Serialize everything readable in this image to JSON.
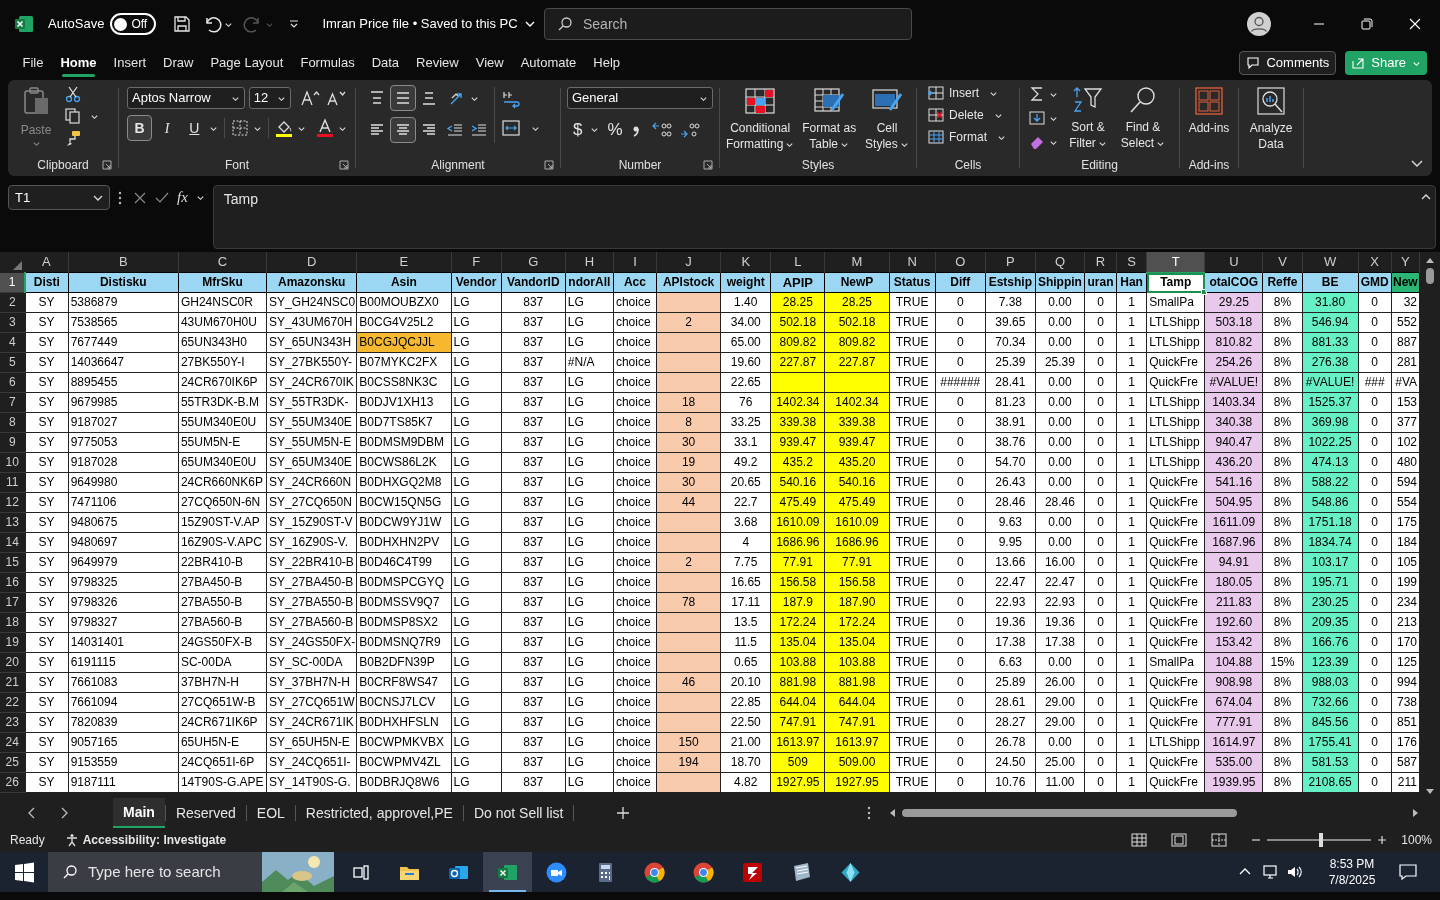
{
  "title_bar": {
    "autosave": "AutoSave",
    "autosave_state": "Off",
    "autosave_on": false,
    "document": "Imran Price file • Saved to this PC",
    "search_placeholder": "Search"
  },
  "menu": [
    {
      "label": "File",
      "selected": false
    },
    {
      "label": "Home",
      "selected": true
    },
    {
      "label": "Insert",
      "selected": false
    },
    {
      "label": "Draw",
      "selected": false
    },
    {
      "label": "Page Layout",
      "selected": false
    },
    {
      "label": "Formulas",
      "selected": false
    },
    {
      "label": "Data",
      "selected": false
    },
    {
      "label": "Review",
      "selected": false
    },
    {
      "label": "View",
      "selected": false
    },
    {
      "label": "Automate",
      "selected": false
    },
    {
      "label": "Help",
      "selected": false
    }
  ],
  "comments": "Comments",
  "share": "Share",
  "ribbon": {
    "clipboard": {
      "paste": "Paste",
      "label": "Clipboard"
    },
    "font": {
      "name": "Aptos Narrow",
      "size": "12",
      "label": "Font",
      "buttons": [
        {
          "label": "B",
          "kind": "bold",
          "selected": true
        },
        {
          "label": "I",
          "kind": "italic",
          "selected": false
        },
        {
          "label": "U",
          "kind": "underline",
          "selected": false
        }
      ]
    },
    "alignment": {
      "label": "Alignment",
      "vertical": [
        {
          "kind": "top",
          "selected": false
        },
        {
          "kind": "middle",
          "selected": true
        },
        {
          "kind": "bottom",
          "selected": false
        }
      ],
      "horizontal": [
        {
          "kind": "left",
          "selected": false
        },
        {
          "kind": "center",
          "selected": true
        },
        {
          "kind": "right",
          "selected": false
        }
      ]
    },
    "number": {
      "format": "General",
      "label": "Number",
      "symbols": [
        "$",
        "%"
      ]
    },
    "styles": {
      "label": "Styles",
      "buttons": [
        "Conditional Formatting",
        "Format as Table",
        "Cell Styles"
      ]
    },
    "cells": {
      "label": "Cells",
      "buttons": [
        "Insert",
        "Delete",
        "Format"
      ]
    },
    "editing": {
      "label": "Editing",
      "buttons": [
        "Sort & Filter",
        "Find & Select"
      ]
    },
    "addins": {
      "label": "Add-ins",
      "button": "Add-ins"
    },
    "analyze": {
      "button": "Analyze Data"
    }
  },
  "formula_bar": {
    "name_box": "T1",
    "function_label": "fx",
    "formula": "Tamp"
  },
  "sheet": {
    "header_row": {
      "number": "1",
      "selected": true
    },
    "columns": [
      {
        "letter": "A",
        "header": "Disti",
        "selected": false
      },
      {
        "letter": "B",
        "header": "Distisku",
        "selected": false
      },
      {
        "letter": "C",
        "header": "MfrSku",
        "selected": false
      },
      {
        "letter": "D",
        "header": "Amazonsku",
        "selected": false
      },
      {
        "letter": "E",
        "header": "Asin",
        "selected": false
      },
      {
        "letter": "F",
        "header": "Vendor",
        "selected": false
      },
      {
        "letter": "G",
        "header": "VandorID",
        "selected": false
      },
      {
        "letter": "H",
        "header": "ndorAll",
        "selected": false
      },
      {
        "letter": "I",
        "header": "Acc",
        "selected": false
      },
      {
        "letter": "J",
        "header": "APIstock",
        "selected": false,
        "color": "#f8cbad"
      },
      {
        "letter": "K",
        "header": "weight",
        "selected": false
      },
      {
        "letter": "L",
        "header": {
          "text": "APIP",
          "kind": "colored-text"
        },
        "selected": false,
        "color": "#ffff00"
      },
      {
        "letter": "M",
        "header": "NewP",
        "selected": false,
        "color": "#ffff00"
      },
      {
        "letter": "N",
        "header": "Status",
        "selected": false
      },
      {
        "letter": "O",
        "header": "Diff",
        "selected": false
      },
      {
        "letter": "P",
        "header": "Estship",
        "selected": false
      },
      {
        "letter": "Q",
        "header": "Shippin",
        "selected": false
      },
      {
        "letter": "R",
        "header": "uran",
        "selected": false
      },
      {
        "letter": "S",
        "header": "Han",
        "selected": false
      },
      {
        "letter": "T",
        "header": "Tamp",
        "selected": true
      },
      {
        "letter": "U",
        "header": "otalCOG",
        "selected": false,
        "color": "#e8c9ec"
      },
      {
        "letter": "V",
        "header": "Reffe",
        "selected": false
      },
      {
        "letter": "W",
        "header": "BE",
        "selected": false,
        "color": "#66f0c6"
      },
      {
        "letter": "X",
        "header": "GMD",
        "selected": false
      },
      {
        "letter": "Y",
        "header": {
          "text": "New",
          "kind": "filled",
          "color": "#2bb673"
        },
        "selected": false
      }
    ],
    "rows": [
      {
        "number": "2",
        "selected": false,
        "cells": [
          "SY",
          "5386879",
          "GH24NSC0R",
          "SY_GH24NSC0",
          "B00MOUBZX0",
          "LG",
          "837",
          "LG",
          "choice",
          null,
          "1.40",
          "28.25",
          "28.25",
          "TRUE",
          "0",
          "7.38",
          "0.00",
          "0",
          "1",
          "SmallPa",
          "29.25",
          "8%",
          "31.80",
          "0",
          "32"
        ]
      },
      {
        "number": "3",
        "selected": false,
        "cells": [
          "SY",
          "7538565",
          "43UM670H0U",
          "SY_43UM670H",
          "B0CG4V25L2",
          "LG",
          "837",
          "LG",
          "choice",
          "2",
          "34.00",
          "502.18",
          "502.18",
          "TRUE",
          "0",
          "39.65",
          "0.00",
          "0",
          "1",
          "LTLShipp",
          "503.18",
          "8%",
          "546.94",
          "0",
          "552"
        ]
      },
      {
        "number": "4",
        "selected": false,
        "cells": [
          "SY",
          "7677449",
          "65UN343H0",
          "SY_65UN343H",
          {
            "text": "B0CGJQCJJL",
            "color": "#f5b82e"
          },
          "LG",
          "837",
          "LG",
          "choice",
          null,
          "65.00",
          "809.82",
          "809.82",
          "TRUE",
          "0",
          "70.34",
          "0.00",
          "0",
          "1",
          "LTLShipp",
          "810.82",
          "8%",
          "881.33",
          "0",
          "887"
        ]
      },
      {
        "number": "5",
        "selected": false,
        "cells": [
          "SY",
          "14036647",
          "27BK550Y-I",
          "SY_27BK550Y-",
          "B07MYKC2FX",
          "LG",
          "837",
          "#N/A",
          "choice",
          null,
          "19.60",
          "227.87",
          "227.87",
          "TRUE",
          "0",
          "25.39",
          "25.39",
          "0",
          "1",
          "QuickFre",
          "254.26",
          "8%",
          "276.38",
          "0",
          "281"
        ]
      },
      {
        "number": "6",
        "selected": false,
        "cells": [
          "SY",
          "8895455",
          "24CR670IK6P",
          "SY_24CR670IK",
          "B0CSS8NK3C",
          "LG",
          "837",
          "LG",
          "choice",
          null,
          "22.65",
          null,
          null,
          "TRUE",
          "######",
          "28.41",
          "0.00",
          "0",
          "1",
          "QuickFre",
          "#VALUE!",
          "8%",
          "#VALUE!",
          "###",
          "#VA"
        ]
      },
      {
        "number": "7",
        "selected": false,
        "cells": [
          "SY",
          "9679985",
          "55TR3DK-B.M",
          "SY_55TR3DK-",
          "B0DJV1XH13",
          "LG",
          "837",
          "LG",
          "choice",
          "18",
          "76",
          "1402.34",
          "1402.34",
          "TRUE",
          "0",
          "81.23",
          "0.00",
          "0",
          "1",
          "LTLShipp",
          "1403.34",
          "8%",
          "1525.37",
          "0",
          "153"
        ]
      },
      {
        "number": "8",
        "selected": false,
        "cells": [
          "SY",
          "9187027",
          "55UM340E0U",
          "SY_55UM340E",
          "B0D7TS85K7",
          "LG",
          "837",
          "LG",
          "choice",
          "8",
          "33.25",
          "339.38",
          "339.38",
          "TRUE",
          "0",
          "38.91",
          "0.00",
          "0",
          "1",
          "LTLShipp",
          "340.38",
          "8%",
          "369.98",
          "0",
          "377"
        ]
      },
      {
        "number": "9",
        "selected": false,
        "cells": [
          "SY",
          "9775053",
          "55UM5N-E",
          "SY_55UM5N-E",
          "B0DMSM9DBM",
          "LG",
          "837",
          "LG",
          "choice",
          "30",
          "33.1",
          "939.47",
          "939.47",
          "TRUE",
          "0",
          "38.76",
          "0.00",
          "0",
          "1",
          "LTLShipp",
          "940.47",
          "8%",
          "1022.25",
          "0",
          "102"
        ]
      },
      {
        "number": "10",
        "selected": false,
        "cells": [
          "SY",
          "9187028",
          "65UM340E0U",
          "SY_65UM340E",
          "B0CWS86L2K",
          "LG",
          "837",
          "LG",
          "choice",
          "19",
          "49.2",
          "435.2",
          "435.20",
          "TRUE",
          "0",
          "54.70",
          "0.00",
          "0",
          "1",
          "LTLShipp",
          "436.20",
          "8%",
          "474.13",
          "0",
          "480"
        ]
      },
      {
        "number": "11",
        "selected": false,
        "cells": [
          "SY",
          "9649980",
          "24CR660NK6P",
          "SY_24CR660N",
          "B0DHXGQ2M8",
          "LG",
          "837",
          "LG",
          "choice",
          "30",
          "20.65",
          "540.16",
          "540.16",
          "TRUE",
          "0",
          "26.43",
          "0.00",
          "0",
          "1",
          "QuickFre",
          "541.16",
          "8%",
          "588.22",
          "0",
          "594"
        ]
      },
      {
        "number": "12",
        "selected": false,
        "cells": [
          "SY",
          "7471106",
          "27CQ650N-6N",
          "SY_27CQ650N",
          "B0CW15QN5G",
          "LG",
          "837",
          "LG",
          "choice",
          "44",
          "22.7",
          "475.49",
          "475.49",
          "TRUE",
          "0",
          "28.46",
          "28.46",
          "0",
          "1",
          "QuickFre",
          "504.95",
          "8%",
          "548.86",
          "0",
          "554"
        ]
      },
      {
        "number": "13",
        "selected": false,
        "cells": [
          "SY",
          "9480675",
          "15Z90ST-V.AP",
          "SY_15Z90ST-V",
          "B0DCW9YJ1W",
          "LG",
          "837",
          "LG",
          "choice",
          null,
          "3.68",
          "1610.09",
          "1610.09",
          "TRUE",
          "0",
          "9.63",
          "0.00",
          "0",
          "1",
          "QuickFre",
          "1611.09",
          "8%",
          "1751.18",
          "0",
          "175"
        ]
      },
      {
        "number": "14",
        "selected": false,
        "cells": [
          "SY",
          "9480697",
          "16Z90S-V.APC",
          "SY_16Z90S-V.",
          "B0DHXHN2PV",
          "LG",
          "837",
          "LG",
          "choice",
          null,
          "4",
          "1686.96",
          "1686.96",
          "TRUE",
          "0",
          "9.95",
          "0.00",
          "0",
          "1",
          "QuickFre",
          "1687.96",
          "8%",
          "1834.74",
          "0",
          "184"
        ]
      },
      {
        "number": "15",
        "selected": false,
        "cells": [
          "SY",
          "9649979",
          "22BR410-B",
          "SY_22BR410-B",
          "B0D46C4T99",
          "LG",
          "837",
          "LG",
          "choice",
          "2",
          "7.75",
          "77.91",
          "77.91",
          "TRUE",
          "0",
          "13.66",
          "16.00",
          "0",
          "1",
          "QuickFre",
          "94.91",
          "8%",
          "103.17",
          "0",
          "105"
        ]
      },
      {
        "number": "16",
        "selected": false,
        "cells": [
          "SY",
          "9798325",
          "27BA450-B",
          "SY_27BA450-B",
          "B0DMSPCGYQ",
          "LG",
          "837",
          "LG",
          "choice",
          null,
          "16.65",
          "156.58",
          "156.58",
          "TRUE",
          "0",
          "22.47",
          "22.47",
          "0",
          "1",
          "QuickFre",
          "180.05",
          "8%",
          "195.71",
          "0",
          "199"
        ]
      },
      {
        "number": "17",
        "selected": false,
        "cells": [
          "SY",
          "9798326",
          "27BA550-B",
          "SY_27BA550-B",
          "B0DMSSV9Q7",
          "LG",
          "837",
          "LG",
          "choice",
          "78",
          "17.11",
          "187.9",
          "187.90",
          "TRUE",
          "0",
          "22.93",
          "22.93",
          "0",
          "1",
          "QuickFre",
          "211.83",
          "8%",
          "230.25",
          "0",
          "234"
        ]
      },
      {
        "number": "18",
        "selected": false,
        "cells": [
          "SY",
          "9798327",
          "27BA560-B",
          "SY_27BA560-B",
          "B0DMSP8SX2",
          "LG",
          "837",
          "LG",
          "choice",
          null,
          "13.5",
          "172.24",
          "172.24",
          "TRUE",
          "0",
          "19.36",
          "19.36",
          "0",
          "1",
          "QuickFre",
          "192.60",
          "8%",
          "209.35",
          "0",
          "213"
        ]
      },
      {
        "number": "19",
        "selected": false,
        "cells": [
          "SY",
          "14031401",
          "24GS50FX-B",
          "SY_24GS50FX-",
          "B0DMSNQ7R9",
          "LG",
          "837",
          "LG",
          "choice",
          null,
          "11.5",
          "135.04",
          "135.04",
          "TRUE",
          "0",
          "17.38",
          "17.38",
          "0",
          "1",
          "QuickFre",
          "153.42",
          "8%",
          "166.76",
          "0",
          "170"
        ]
      },
      {
        "number": "20",
        "selected": false,
        "cells": [
          "SY",
          "6191115",
          "SC-00DA",
          "SY_SC-00DA",
          "B0B2DFN39P",
          "LG",
          "837",
          "LG",
          "choice",
          null,
          "0.65",
          "103.88",
          "103.88",
          "TRUE",
          "0",
          "6.63",
          "0.00",
          "0",
          "1",
          "SmallPa",
          "104.88",
          "15%",
          "123.39",
          "0",
          "125"
        ]
      },
      {
        "number": "21",
        "selected": false,
        "cells": [
          "SY",
          "7661083",
          "37BH7N-H",
          "SY_37BH7N-H",
          "B0CRF8WS47",
          "LG",
          "837",
          "LG",
          "choice",
          "46",
          "20.10",
          "881.98",
          "881.98",
          "TRUE",
          "0",
          "25.89",
          "26.00",
          "0",
          "1",
          "QuickFre",
          "908.98",
          "8%",
          "988.03",
          "0",
          "994"
        ]
      },
      {
        "number": "22",
        "selected": false,
        "cells": [
          "SY",
          "7661094",
          "27CQ651W-B",
          "SY_27CQ651W",
          "B0CNSJ7LCV",
          "LG",
          "837",
          "LG",
          "choice",
          null,
          "22.85",
          "644.04",
          "644.04",
          "TRUE",
          "0",
          "28.61",
          "29.00",
          "0",
          "1",
          "QuickFre",
          "674.04",
          "8%",
          "732.66",
          "0",
          "738"
        ]
      },
      {
        "number": "23",
        "selected": false,
        "cells": [
          "SY",
          "7820839",
          "24CR671IK6P",
          "SY_24CR671IK",
          "B0DHXHFSLN",
          "LG",
          "837",
          "LG",
          "choice",
          null,
          "22.50",
          "747.91",
          "747.91",
          "TRUE",
          "0",
          "28.27",
          "29.00",
          "0",
          "1",
          "QuickFre",
          "777.91",
          "8%",
          "845.56",
          "0",
          "851"
        ]
      },
      {
        "number": "24",
        "selected": false,
        "cells": [
          "SY",
          "9057165",
          "65UH5N-E",
          "SY_65UH5N-E",
          "B0CWPMKVBX",
          "LG",
          "837",
          "LG",
          "choice",
          "150",
          "21.00",
          "1613.97",
          "1613.97",
          "TRUE",
          "0",
          "26.78",
          "0.00",
          "0",
          "1",
          "LTLShipp",
          "1614.97",
          "8%",
          "1755.41",
          "0",
          "176"
        ]
      },
      {
        "number": "25",
        "selected": false,
        "cells": [
          "SY",
          "9153559",
          "24CQ651I-6P",
          "SY_24CQ651I-",
          "B0CWPMV4ZL",
          "LG",
          "837",
          "LG",
          "choice",
          "194",
          "18.70",
          "509",
          "509.00",
          "TRUE",
          "0",
          "24.50",
          "25.00",
          "0",
          "1",
          "QuickFre",
          "535.00",
          "8%",
          "581.53",
          "0",
          "587"
        ]
      },
      {
        "number": "26",
        "selected": false,
        "cells": [
          "SY",
          "9187111",
          "14T90S-G.APE",
          "SY_14T90S-G.",
          "B0DBRJQ8W6",
          "LG",
          "837",
          "LG",
          "choice",
          null,
          "4.82",
          "1927.95",
          "1927.95",
          "TRUE",
          "0",
          "10.76",
          "11.00",
          "0",
          "1",
          "QuickFre",
          "1939.95",
          "8%",
          "2108.65",
          "0",
          "211"
        ]
      }
    ]
  },
  "sheet_tabs": [
    {
      "label": "Main",
      "selected": true
    },
    {
      "label": "Reserved",
      "selected": false
    },
    {
      "label": "EOL",
      "selected": false
    },
    {
      "label": "Restricted, approvel,PE",
      "selected": false
    },
    {
      "label": "Do not Sell list",
      "selected": false
    }
  ],
  "status_bar": {
    "mode": "Ready",
    "accessibility": "Accessibility: Investigate",
    "zoom": "100%",
    "zoom_slider": {
      "level": 0.5
    }
  },
  "taskbar": {
    "search_placeholder": "Type here to search",
    "time": "8:53 PM",
    "date": "7/8/2025",
    "apps": [
      {
        "kind": "taskview",
        "active": false
      },
      {
        "kind": "folder",
        "active": false
      },
      {
        "kind": "mail",
        "active": false
      },
      {
        "kind": "sheet",
        "active": true
      },
      {
        "kind": "video",
        "active": false
      },
      {
        "kind": "calculator",
        "active": false
      },
      {
        "kind": "browser",
        "active": false
      },
      {
        "kind": "browser",
        "active": false
      },
      {
        "kind": "ftp",
        "active": false
      },
      {
        "kind": "notes",
        "active": false
      },
      {
        "kind": "diamond",
        "active": false
      }
    ]
  }
}
